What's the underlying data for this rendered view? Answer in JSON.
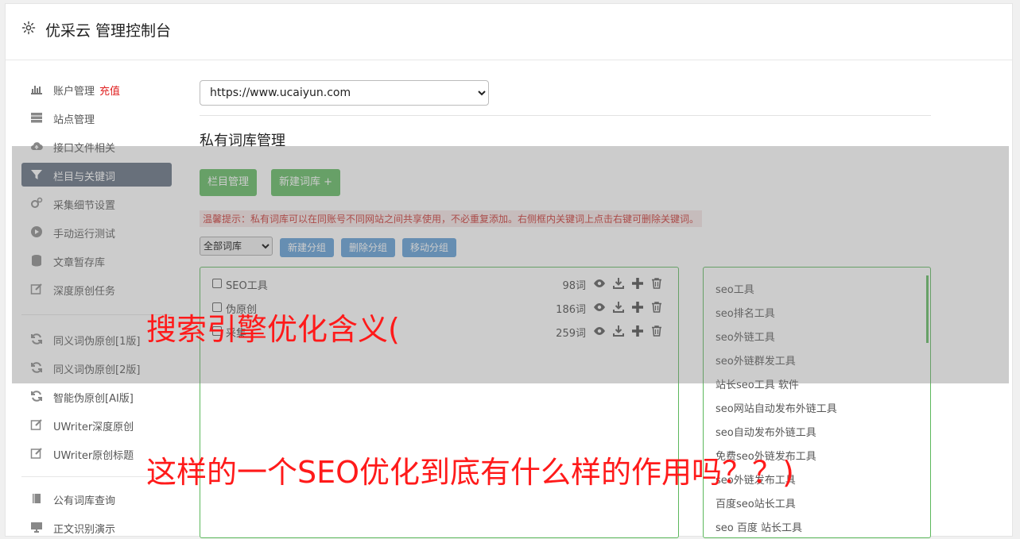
{
  "header": {
    "title": "优采云 管理控制台",
    "icon": "gear-icon"
  },
  "sidebar": {
    "items": [
      {
        "label": "账户管理",
        "badge": "充值",
        "icon": "bar-chart-icon"
      },
      {
        "label": "站点管理",
        "icon": "server-icon"
      },
      {
        "label": "接口文件相关",
        "icon": "cloud-upload-icon"
      },
      {
        "label": "栏目与关键词",
        "icon": "filter-icon",
        "active": true
      },
      {
        "label": "采集细节设置",
        "icon": "cogs-icon"
      },
      {
        "label": "手动运行测试",
        "icon": "play-circle-icon"
      },
      {
        "label": "文章暂存库",
        "icon": "database-icon"
      },
      {
        "label": "深度原创任务",
        "icon": "edit-icon"
      },
      {
        "label": "同义词伪原创[1版]",
        "icon": "refresh-icon"
      },
      {
        "label": "同义词伪原创[2版]",
        "icon": "refresh-icon"
      },
      {
        "label": "智能伪原创[AI版]",
        "icon": "refresh-icon"
      },
      {
        "label": "UWriter深度原创",
        "icon": "edit-icon"
      },
      {
        "label": "UWriter原创标题",
        "icon": "edit-icon"
      },
      {
        "label": "公有词库查询",
        "icon": "book-icon"
      },
      {
        "label": "正文识别演示",
        "icon": "monitor-icon"
      }
    ]
  },
  "main": {
    "site_select": "https://www.ucaiyun.com",
    "section_title": "私有词库管理",
    "buttons": {
      "column_manage": "栏目管理",
      "new_library": "新建词库 +"
    },
    "tip": "温馨提示：私有词库可以在同账号不同网站之间共享使用，不必重复添加。右侧框内关键词上点击右键可删除关键词。",
    "filter_select": "全部词库",
    "group_buttons": {
      "new_group": "新建分组",
      "delete_group": "删除分组",
      "move_group": "移动分组"
    },
    "libraries": [
      {
        "name": "SEO工具",
        "count": "98词"
      },
      {
        "name": "伪原创",
        "count": "186词"
      },
      {
        "name": "采集",
        "count": "259词"
      }
    ],
    "keywords": [
      "seo工具",
      "seo排名工具",
      "seo外链工具",
      "seo外链群发工具",
      "站长seo工具 软件",
      "seo网站自动发布外链工具",
      "seo自动发布外链工具",
      "免费seo外链发布工具",
      "seo外链发布工具",
      "百度seo站长工具",
      "seo 百度 站长工具"
    ]
  },
  "overlay_text": {
    "line1": "搜索引擎优化含义(",
    "line2": "这样的一个SEO优化到底有什么样的作用吗？？)"
  },
  "colors": {
    "accent_green": "#5cb85c",
    "accent_blue": "#5b9bd5",
    "sidebar_active": "#5e6b7d",
    "overlay_text": "#ff1a1a"
  }
}
